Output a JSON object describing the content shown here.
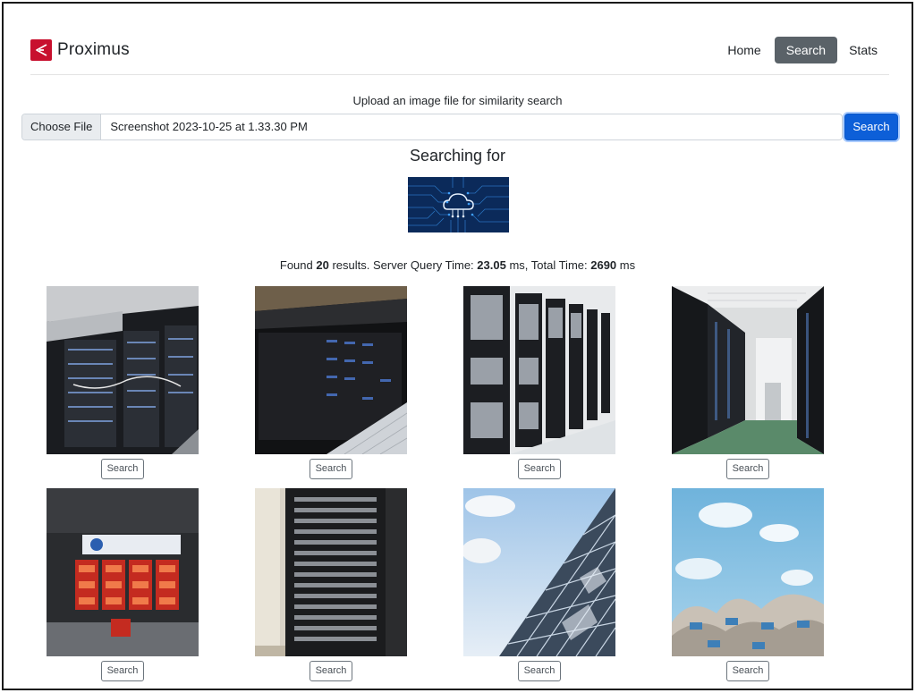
{
  "brand": {
    "name": "Proximus",
    "color": "#c8102e"
  },
  "nav": {
    "home": "Home",
    "search": "Search",
    "stats": "Stats"
  },
  "upload": {
    "label": "Upload an image file for similarity search",
    "choose_label": "Choose File",
    "file_name": "Screenshot 2023-10-25 at 1.33.30 PM",
    "search_label": "Search"
  },
  "searching_title": "Searching for",
  "results": {
    "prefix": "Found ",
    "count": "20",
    "mid1": " results. Server Query Time: ",
    "server_time": "23.05",
    "mid2": " ms, Total Time: ",
    "total_time": "2690",
    "suffix": " ms"
  },
  "result_items": [
    {
      "button_label": "Search"
    },
    {
      "button_label": "Search"
    },
    {
      "button_label": "Search"
    },
    {
      "button_label": "Search"
    },
    {
      "button_label": "Search"
    },
    {
      "button_label": "Search"
    },
    {
      "button_label": "Search"
    },
    {
      "button_label": "Search"
    }
  ]
}
